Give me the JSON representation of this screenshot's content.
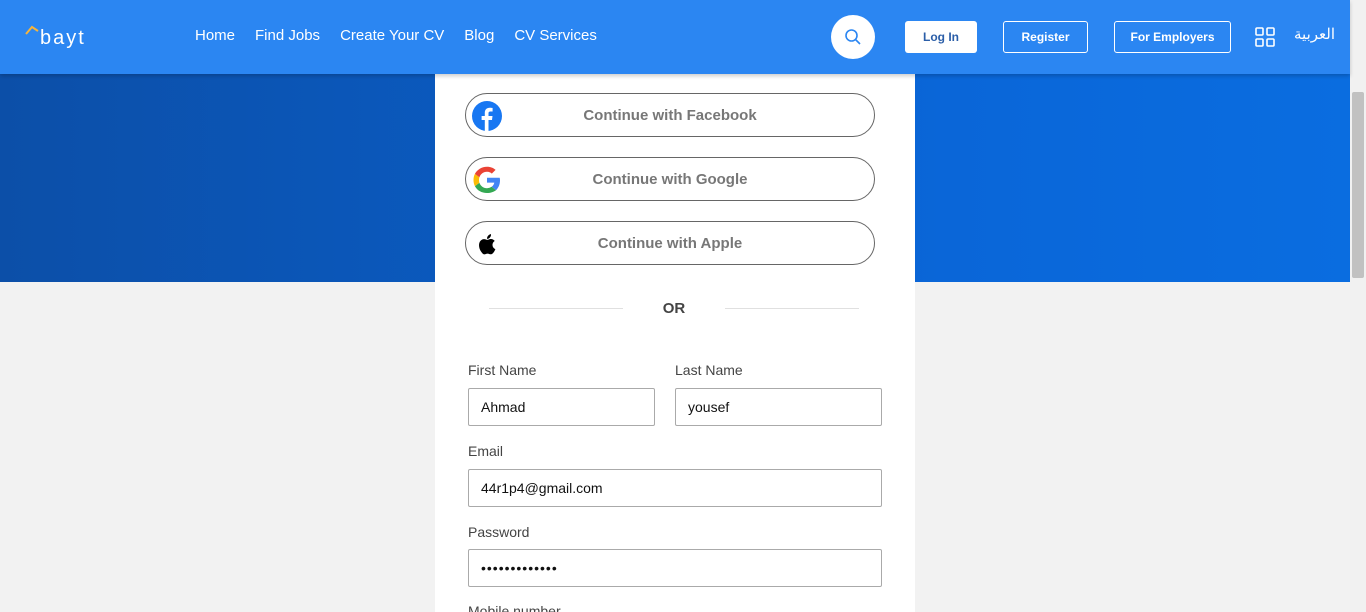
{
  "header": {
    "logo_text": "bayt",
    "nav": [
      "Home",
      "Find Jobs",
      "Create Your CV",
      "Blog",
      "CV Services"
    ],
    "login": "Log In",
    "register": "Register",
    "employers": "For Employers",
    "language": "العربية"
  },
  "signup": {
    "facebook": "Continue with Facebook",
    "google": "Continue with Google",
    "apple": "Continue with Apple",
    "or": "OR",
    "first_name_label": "First Name",
    "first_name_value": "Ahmad",
    "last_name_label": "Last Name",
    "last_name_value": "yousef",
    "email_label": "Email",
    "email_value": "44r1p4@gmail.com",
    "password_label": "Password",
    "password_value": "•••••••••••••",
    "mobile_label": "Mobile number"
  },
  "colors": {
    "header_bg": "#2b86f2",
    "hero_bg": "#0a5cc4",
    "facebook": "#1877f2"
  },
  "icons": [
    "search-icon",
    "grid-icon",
    "facebook-icon",
    "google-icon",
    "apple-icon"
  ]
}
